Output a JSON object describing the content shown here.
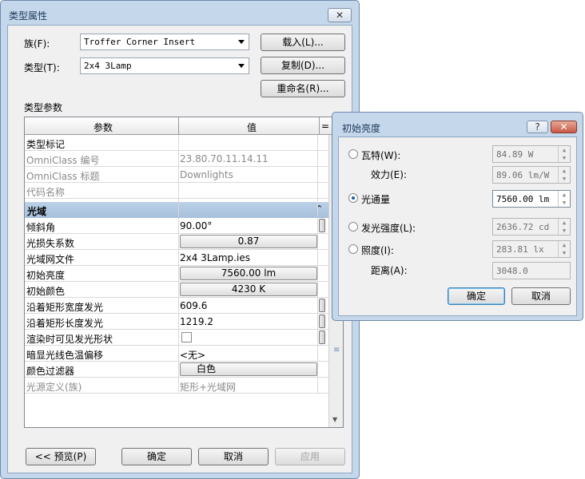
{
  "main_dialog": {
    "title": "类型属性",
    "close": "✕",
    "family_label": "族(F):",
    "family_value": "Troffer Corner Insert",
    "type_label": "类型(T):",
    "type_value": "2x4 3Lamp",
    "load_button": "载入(L)...",
    "duplicate_button": "复制(D)...",
    "rename_button": "重命名(R)...",
    "type_params_label": "类型参数",
    "col_param": "参数",
    "col_value": "值",
    "col_extra": "=",
    "rows_top": [
      {
        "name": "类型标记",
        "value": ""
      },
      {
        "name": "OmniClass 编号",
        "value": "23.80.70.11.14.11"
      },
      {
        "name": "OmniClass 标题",
        "value": "Downlights"
      },
      {
        "name": "代码名称",
        "value": ""
      }
    ],
    "group_header": "光域",
    "group_toggle": "⌃",
    "rows": [
      {
        "name": "倾斜角",
        "value": "90.00°"
      },
      {
        "name": "光损失系数",
        "value": "0.87"
      },
      {
        "name": "光域网文件",
        "value": "2x4 3Lamp.ies"
      },
      {
        "name": "初始亮度",
        "value": "7560.00 lm"
      },
      {
        "name": "初始颜色",
        "value": "4230 K"
      },
      {
        "name": "沿着矩形宽度发光",
        "value": "609.6"
      },
      {
        "name": "沿着矩形长度发光",
        "value": "1219.2"
      },
      {
        "name": "渲染时可见发光形状",
        "value": ""
      },
      {
        "name": "暗显光线色温偏移",
        "value": "<无>"
      },
      {
        "name": "颜色过滤器",
        "value": "白色"
      },
      {
        "name": "光源定义(族)",
        "value": "矩形+光域网"
      }
    ],
    "preview_button": "<< 预览(P)",
    "ok_button": "确定",
    "cancel_button": "取消",
    "apply_button": "应用"
  },
  "lumen_dialog": {
    "title": "初始亮度",
    "help": "?",
    "close": "✕",
    "watt_label": "瓦特(W):",
    "watt_value": "84.89 W",
    "efficacy_label": "效力(E):",
    "efficacy_value": "89.06 lm/W",
    "flux_label": "光通量",
    "flux_value": "7560.00 lm",
    "intensity_label": "发光强度(L):",
    "intensity_value": "2636.72 cd",
    "illum_label": "照度(I):",
    "illum_value": "283.81 lx",
    "distance_label": "距离(A):",
    "distance_value": "3048.0",
    "ok_button": "确定",
    "cancel_button": "取消"
  }
}
